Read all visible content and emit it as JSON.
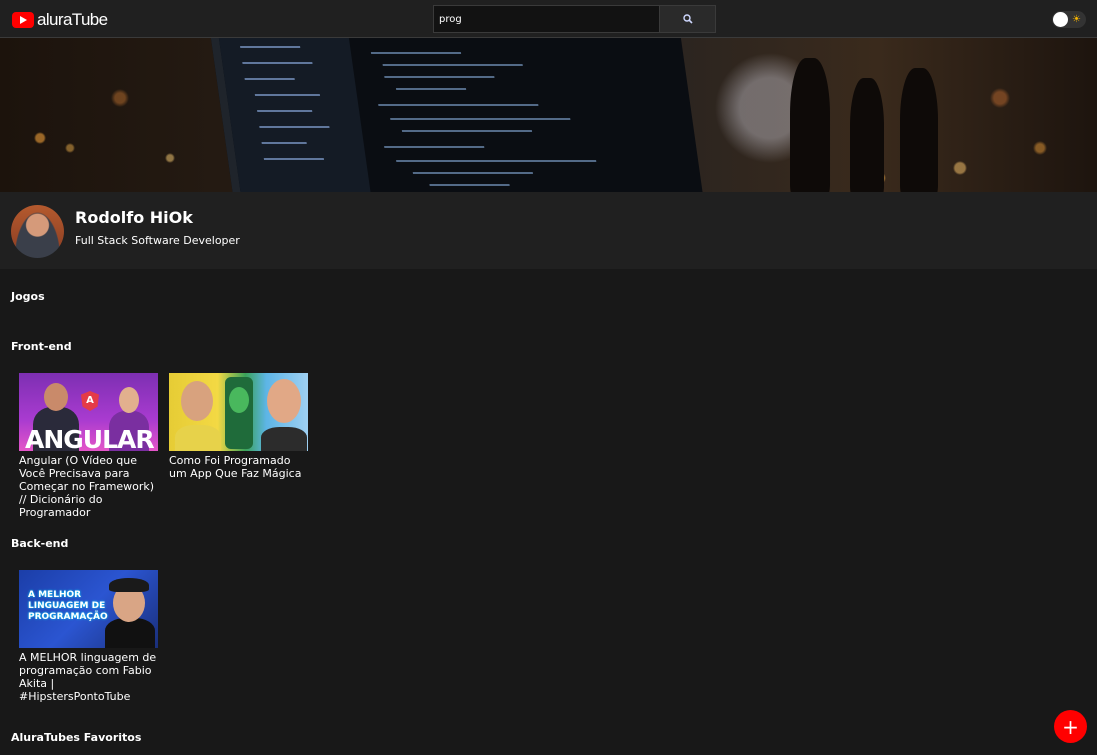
{
  "header": {
    "logo_text": "aluraTube",
    "search": {
      "value": "prog",
      "placeholder": ""
    },
    "search_button_icon": "search-icon",
    "theme_toggle": {
      "state": "dark",
      "icon": "sun-icon",
      "glyph": "☀"
    }
  },
  "profile": {
    "name": "Rodolfo HiOk",
    "role": "Full Stack Software Developer"
  },
  "sections": [
    {
      "title": "Jogos",
      "videos": []
    },
    {
      "title": "Front-end",
      "videos": [
        {
          "title": "Angular (O Vídeo que Você Precisava para Começar no Framework) // Dicionário do Programador",
          "thumb_text": "ANGULAR",
          "thumb_badge": "A"
        },
        {
          "title": "Como Foi Programado um App Que Faz Mágica"
        }
      ]
    },
    {
      "title": "Back-end",
      "videos": [
        {
          "title": "A MELHOR linguagem de programação com Fabio Akita | #HipstersPontoTube",
          "thumb_text": "A MELHOR LINGUAGEM DE PROGRAMAÇÃO"
        }
      ]
    },
    {
      "title": "AluraTubes Favoritos",
      "videos": []
    }
  ],
  "fab": {
    "label": "+"
  },
  "colors": {
    "accent": "#ff0000",
    "background": "#181818",
    "surface": "#202020"
  }
}
